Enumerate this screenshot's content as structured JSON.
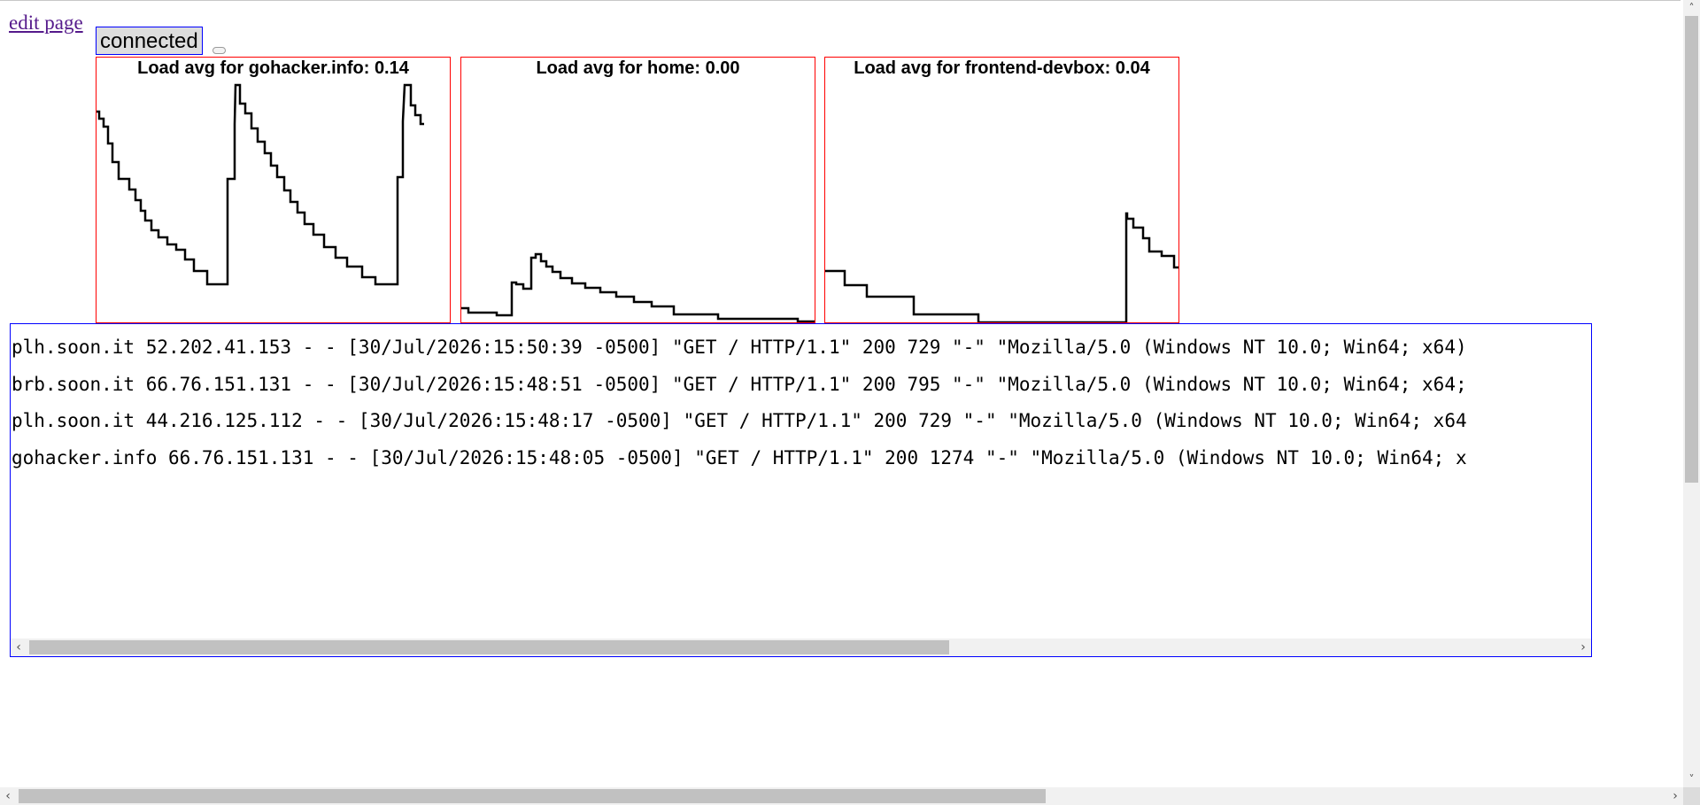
{
  "header": {
    "edit_link": "edit page",
    "status": "connected"
  },
  "charts": [
    {
      "title": "Load avg for gohacker.info: 0.14"
    },
    {
      "title": "Load avg for home: 0.00"
    },
    {
      "title": "Load avg for frontend-devbox: 0.04"
    }
  ],
  "log": {
    "lines": [
      "plh.soon.it 52.202.41.153 - - [30/Jul/2026:15:50:39 -0500] \"GET / HTTP/1.1\" 200 729 \"-\" \"Mozilla/5.0 (Windows NT 10.0; Win64; x64)",
      "brb.soon.it 66.76.151.131 - - [30/Jul/2026:15:48:51 -0500] \"GET / HTTP/1.1\" 200 795 \"-\" \"Mozilla/5.0 (Windows NT 10.0; Win64; x64;",
      "plh.soon.it 44.216.125.112 - - [30/Jul/2026:15:48:17 -0500] \"GET / HTTP/1.1\" 200 729 \"-\" \"Mozilla/5.0 (Windows NT 10.0; Win64; x64",
      "gohacker.info 66.76.151.131 - - [30/Jul/2026:15:48:05 -0500] \"GET / HTTP/1.1\" 200 1274 \"-\" \"Mozilla/5.0 (Windows NT 10.0; Win64; x"
    ]
  },
  "scrollbars": {
    "left_arrow": "‹",
    "right_arrow": "›",
    "up_arrow": "˄",
    "down_arrow": "˅"
  }
}
